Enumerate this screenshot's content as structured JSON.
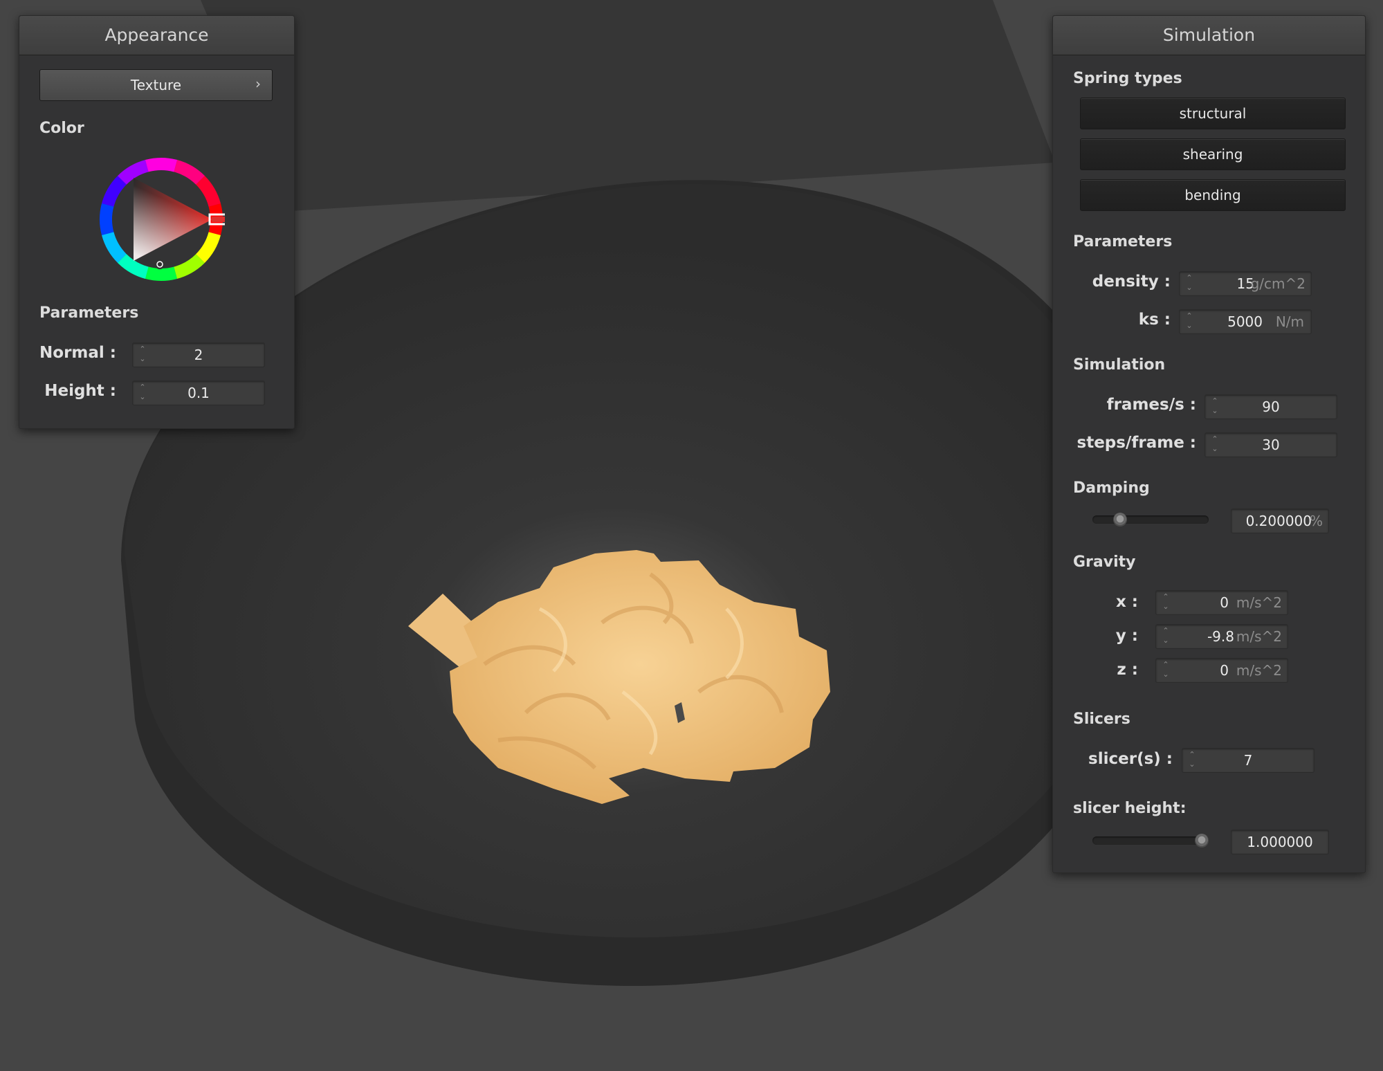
{
  "appearance": {
    "title": "Appearance",
    "texture_button": "Texture",
    "texture_chevron": "›",
    "color_label": "Color",
    "color_wheel_icon": "color-wheel",
    "selected_color": "#e0312d",
    "parameters_label": "Parameters",
    "normal": {
      "label": "Normal :",
      "value": "2"
    },
    "height": {
      "label": "Height :",
      "value": "0.1"
    }
  },
  "simulation": {
    "title": "Simulation",
    "spring_types_label": "Spring types",
    "spring_types": [
      "structural",
      "shearing",
      "bending"
    ],
    "parameters_label": "Parameters",
    "density": {
      "label": "density :",
      "value": "15",
      "unit": "g/cm^2"
    },
    "ks": {
      "label": "ks :",
      "value": "5000",
      "unit": "N/m"
    },
    "simulation_label": "Simulation",
    "frames_per_s": {
      "label": "frames/s :",
      "value": "90"
    },
    "steps_per_frame": {
      "label": "steps/frame :",
      "value": "30"
    },
    "damping_label": "Damping",
    "damping": {
      "value": "0.200000",
      "unit": "%",
      "slider_fraction": 0.2
    },
    "gravity_label": "Gravity",
    "gravity": {
      "x": {
        "label": "x :",
        "value": "0",
        "unit": "m/s^2"
      },
      "y": {
        "label": "y :",
        "value": "-9.8",
        "unit": "m/s^2"
      },
      "z": {
        "label": "z :",
        "value": "0",
        "unit": "m/s^2"
      }
    },
    "slicers_label": "Slicers",
    "slicers": {
      "label": "slicer(s) :",
      "value": "7"
    },
    "slicer_height_label": "slicer height:",
    "slicer_height": {
      "value": "1.000000",
      "slider_fraction": 1.0
    }
  },
  "colors": {
    "background": "#454545",
    "bowl": "#2e2e2e",
    "cloth": "#f0c27a",
    "panel": "#333334"
  }
}
